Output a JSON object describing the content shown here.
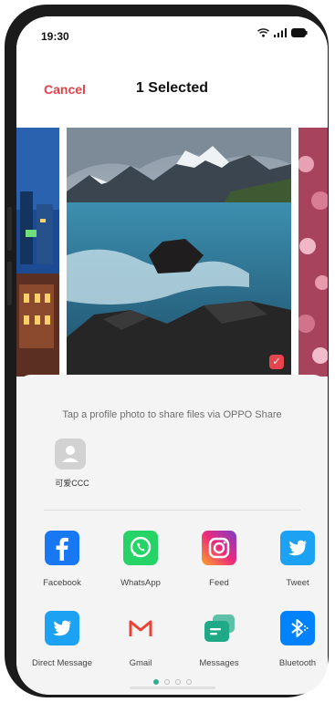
{
  "status_bar": {
    "time": "19:30",
    "icons": [
      "wifi-icon",
      "signal-icon",
      "battery-icon"
    ]
  },
  "header": {
    "cancel_label": "Cancel",
    "title": "1 Selected"
  },
  "photos": [
    {
      "name": "city-night-photo",
      "selected": false
    },
    {
      "name": "lake-mountains-photo",
      "selected": true
    },
    {
      "name": "pink-flowers-photo",
      "selected": false
    }
  ],
  "share": {
    "hint": "Tap a profile photo to share files via OPPO Share",
    "contact": {
      "name": "可爱CCC",
      "icon": "person-icon"
    }
  },
  "apps": [
    {
      "label": "Facebook",
      "icon": "facebook-icon",
      "color": "#1877f2"
    },
    {
      "label": "WhatsApp",
      "icon": "whatsapp-icon",
      "color": "#25d366"
    },
    {
      "label": "Feed",
      "icon": "instagram-icon",
      "color": "#d6249f"
    },
    {
      "label": "Tweet",
      "icon": "twitter-icon",
      "color": "#1da1f2"
    },
    {
      "label": "Direct Message",
      "icon": "twitter-icon",
      "color": "#1da1f2"
    },
    {
      "label": "Gmail",
      "icon": "gmail-icon",
      "color": "#ea4335"
    },
    {
      "label": "Messages",
      "icon": "messages-icon",
      "color": "#1fa987"
    },
    {
      "label": "Bluetooth",
      "icon": "bluetooth-icon",
      "color": "#0082fc"
    }
  ],
  "pager": {
    "pages": 4,
    "current": 1
  },
  "colors": {
    "accent": "#e2434a",
    "active_dot": "#2fae8f"
  }
}
